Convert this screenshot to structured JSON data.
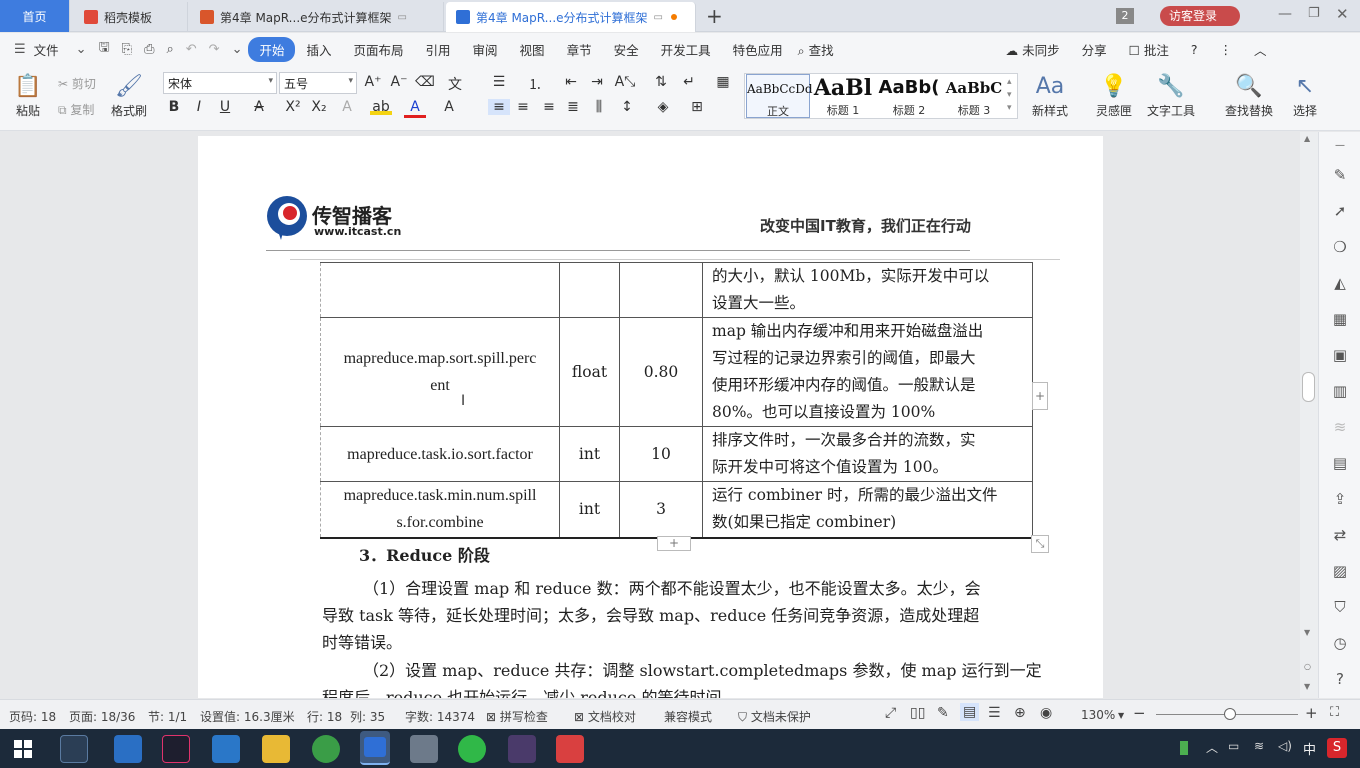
{
  "tabs": {
    "home": "首页",
    "t1": "稻壳模板",
    "t2": "第4章 MapR...e分布式计算框架",
    "t3": "第4章 MapR...e分布式计算框架",
    "new_tab": "+",
    "badge": "2",
    "login": "访客登录"
  },
  "menu": {
    "file": "文件",
    "items": [
      "开始",
      "插入",
      "页面布局",
      "引用",
      "审阅",
      "视图",
      "章节",
      "安全",
      "开发工具",
      "特色应用"
    ],
    "search": "查找",
    "sync": "未同步",
    "share": "分享",
    "comment": "批注",
    "help": "?"
  },
  "ribbon": {
    "paste": "粘贴",
    "cut": "剪切",
    "copy": "复制",
    "format_painter": "格式刷",
    "font_name": "宋体",
    "font_size": "五号",
    "styles": [
      {
        "preview": "AaBbCcDd",
        "name": "正文"
      },
      {
        "preview": "AaBl",
        "name": "标题 1"
      },
      {
        "preview": "AaBb(",
        "name": "标题 2"
      },
      {
        "preview": "AaBbC",
        "name": "标题 3"
      }
    ],
    "new_style": "新样式",
    "inspiration": "灵感匣",
    "text_tools": "文字工具",
    "find_replace": "查找替换",
    "select": "选择"
  },
  "header": {
    "logo_cn": "传智播客",
    "logo_url": "www.itcast.cn",
    "slogan": "改变中国IT教育，我们正在行动"
  },
  "table": {
    "rows": [
      {
        "name": "",
        "type": "",
        "default": "",
        "desc": [
          "的大小，默认 100Mb，实际开发中可以",
          "设置大一些。"
        ]
      },
      {
        "name": "mapreduce.map.sort.spill.percent",
        "type": "float",
        "default": "0.80",
        "desc": [
          "map 输出内存缓冲和用来开始磁盘溢出",
          "写过程的记录边界索引的阈值，即最大",
          "使用环形缓冲内存的阈值。一般默认是",
          "80%。也可以直接设置为 100%"
        ]
      },
      {
        "name": "mapreduce.task.io.sort.factor",
        "type": "int",
        "default": "10",
        "desc": [
          "排序文件时，一次最多合并的流数，实",
          "际开发中可将这个值设置为 100。"
        ]
      },
      {
        "name": "mapreduce.task.min.num.spills.for.combine",
        "type": "int",
        "default": "3",
        "desc": [
          "运行 combiner 时，所需的最少溢出文件",
          "数(如果已指定 combiner)"
        ]
      }
    ],
    "name_wrap": {
      "r1a": "mapreduce.map.sort.spill.perc",
      "r1b": "ent",
      "r3a": "mapreduce.task.min.num.spill",
      "r3b": "s.for.combine"
    }
  },
  "body": {
    "heading": "3．Reduce 阶段",
    "p1a": "（1）合理设置 map 和 reduce 数：两个都不能设置太少，也不能设置太多。太少，会",
    "p1b": "导致 task 等待，延长处理时间；太多，会导致  map、reduce 任务间竞争资源，造成处理超",
    "p1c": "时等错误。",
    "p2a": "（2）设置 map、reduce 共存：调整 slowstart.completedmaps 参数，使 map 运行到一定",
    "p2b": "程度后，reduce 也开始运行，减少 reduce 的等待时间。"
  },
  "status": {
    "page_code": "页码: 18",
    "page": "页面: 18/36",
    "section": "节: 1/1",
    "setting": "设置值: 16.3厘米",
    "row": "行: 18",
    "col": "列: 35",
    "words": "字数: 14374",
    "spell": "拼写检查",
    "proof": "文档校对",
    "compat": "兼容模式",
    "protect": "文档未保护",
    "zoom": "130%"
  },
  "taskbar": {
    "ime": "中"
  },
  "colors": {
    "accent": "#3e7cdf",
    "login_btn": "#c94b4b"
  }
}
